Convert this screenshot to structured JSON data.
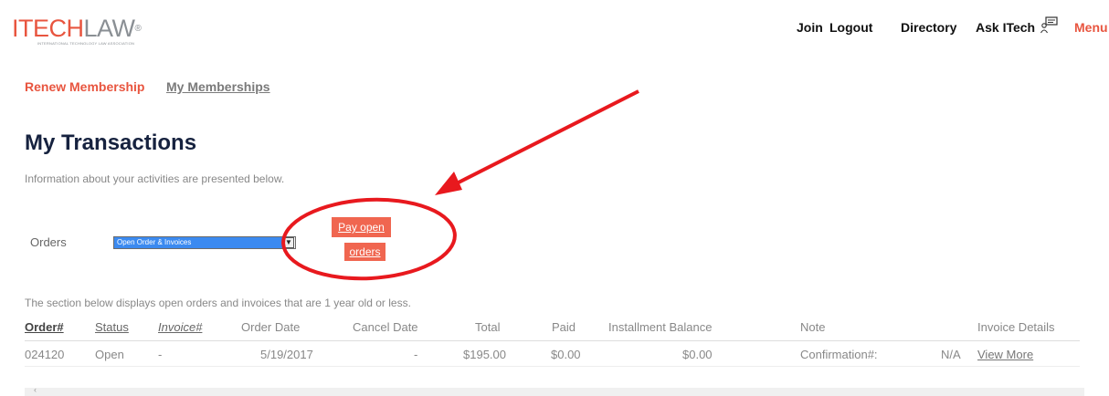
{
  "header": {
    "logo_main": "ITECH",
    "logo_law": "LAW",
    "logo_reg": "®",
    "logo_sub": "INTERNATIONAL TECHNOLOGY LAW ASSOCIATION",
    "nav": {
      "join": "Join",
      "logout": "Logout",
      "directory": "Directory",
      "ask": "Ask ITech",
      "menu": "Menu"
    }
  },
  "subnav": {
    "renew": "Renew Membership",
    "my_memberships": "My Memberships"
  },
  "page": {
    "title": "My Transactions",
    "intro": "Information about your activities are presented below."
  },
  "orders": {
    "label": "Orders",
    "selected": "Open Order & Invoices",
    "pay_line1": "Pay open",
    "pay_line2": "orders"
  },
  "section_note": "The section below displays open orders and invoices that are 1 year old or less.",
  "table": {
    "headers": {
      "order": "Order#",
      "status": "Status",
      "invoice": "Invoice#",
      "order_date": "Order Date",
      "cancel_date": "Cancel Date",
      "total": "Total",
      "paid": "Paid",
      "installment": "Installment Balance",
      "note": "Note",
      "invoice_details": "Invoice Details"
    },
    "rows": [
      {
        "order": "024120",
        "status": "Open",
        "invoice": "-",
        "order_date": "5/19/2017",
        "cancel_date": "-",
        "total": "$195.00",
        "paid": "$0.00",
        "installment": "$0.00",
        "note_label": "Confirmation#:",
        "note_value": "N/A",
        "details": "View More"
      }
    ]
  },
  "colors": {
    "accent": "#e8553f",
    "title": "#16223f",
    "annotation": "#e8191e"
  }
}
